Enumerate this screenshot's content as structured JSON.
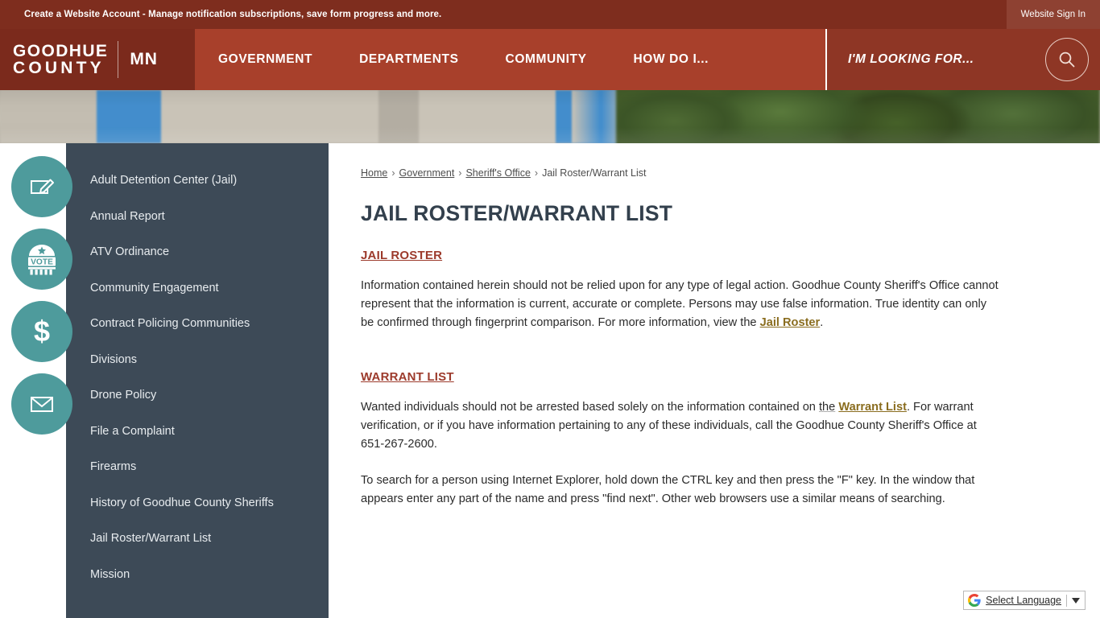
{
  "top_bar": {
    "message": "Create a Website Account - Manage notification subscriptions, save form progress and more.",
    "sign_in_label": "Website Sign In",
    "bg_color": "#7e2d1e"
  },
  "header": {
    "logo_line1": "GOODHUE",
    "logo_line2": "COUNTY",
    "state_abbr": "MN",
    "nav_items": [
      {
        "label": "GOVERNMENT"
      },
      {
        "label": "DEPARTMENTS"
      },
      {
        "label": "COMMUNITY"
      },
      {
        "label": "HOW DO I..."
      }
    ],
    "looking_for_label": "I'M LOOKING FOR...",
    "search_icon": "search-icon",
    "nav_bg_color": "#a8402b",
    "logo_bg_color": "#7b2a1c"
  },
  "quick_icons": [
    {
      "name": "form-pencil-icon",
      "meaning": "Forms / Notify"
    },
    {
      "name": "vote-icon",
      "meaning": "Elections / Vote",
      "text": "VOTE"
    },
    {
      "name": "dollar-sign-icon",
      "meaning": "Pay Online"
    },
    {
      "name": "envelope-icon",
      "meaning": "Contact Us"
    }
  ],
  "sidebar": {
    "bg_color": "#3d4a57",
    "items": [
      {
        "label": "Adult Detention Center (Jail)"
      },
      {
        "label": "Annual Report"
      },
      {
        "label": "ATV Ordinance"
      },
      {
        "label": "Community Engagement"
      },
      {
        "label": "Contract Policing Communities"
      },
      {
        "label": "Divisions"
      },
      {
        "label": "Drone Policy"
      },
      {
        "label": "File a Complaint"
      },
      {
        "label": "Firearms"
      },
      {
        "label": "History of Goodhue County Sheriffs"
      },
      {
        "label": "Jail Roster/Warrant List"
      },
      {
        "label": "Mission"
      }
    ]
  },
  "breadcrumb": {
    "items": [
      {
        "label": "Home",
        "link": true
      },
      {
        "label": "Government",
        "link": true
      },
      {
        "label": "Sheriff's Office",
        "link": true
      },
      {
        "label": "Jail Roster/Warrant List",
        "link": false
      }
    ],
    "separator": "›"
  },
  "main": {
    "title": "JAIL ROSTER/WARRANT LIST",
    "section_1": {
      "heading": "JAIL ROSTER",
      "paragraph_start": "Information contained herein should not be relied upon for any type of legal action. Goodhue County Sheriff's Office cannot represent that the information is current, accurate or complete. Persons may use false information. True identity can only be confirmed through fingerprint comparison. For more information, view the ",
      "link_text": "Jail Roster",
      "paragraph_end": "."
    },
    "section_2": {
      "heading": "WARRANT LIST",
      "paragraph_start": "Wanted individuals should not be arrested based solely on the information contained on ",
      "emphasis_word": "the",
      "link_text": "Warrant List",
      "paragraph_end": ". For warrant verification, or if you have information pertaining to any of these individuals, call the Goodhue County Sheriff's Office at 651-267-2600."
    },
    "section_3": {
      "paragraph": "To search for a person using Internet Explorer, hold down the CTRL key and then press the \"F\" key. In the window that appears enter any part of the name and press \"find next\". Other web browsers use a similar means of searching."
    },
    "link_color": "#8a6d1f",
    "heading_color": "#9c3a2b"
  },
  "translate_widget": {
    "label": "Select Language",
    "logo": "google-g-icon",
    "caret": "chevron-down-icon"
  }
}
